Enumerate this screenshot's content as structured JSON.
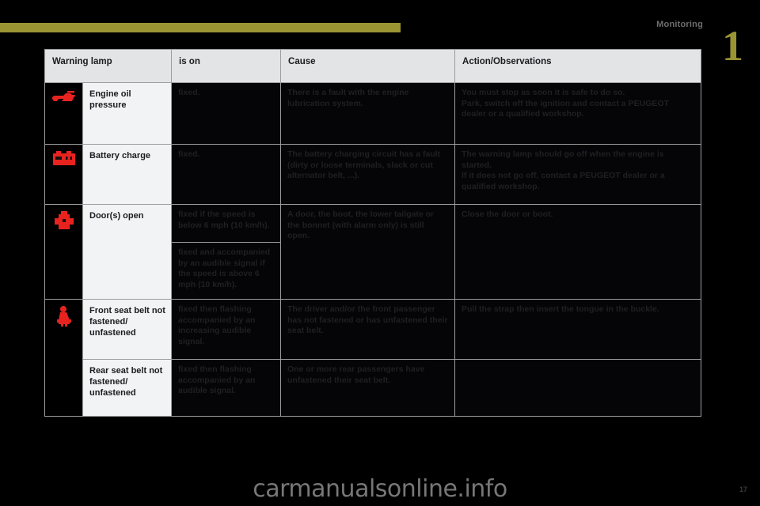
{
  "header": {
    "running_head": "Monitoring",
    "chapter_number": "1"
  },
  "table": {
    "columns": [
      "Warning lamp",
      "is on",
      "Cause",
      "Action/Observations"
    ],
    "rows": [
      {
        "icon": "engine-oil-pressure-icon",
        "lamp": "Engine oil pressure",
        "is_on": [
          "fixed."
        ],
        "cause": "There is a fault with the engine lubrication system.",
        "action": "You must stop as soon it is safe to do so.\nPark, switch off the ignition and contact a PEUGEOT dealer or a qualified workshop."
      },
      {
        "icon": "battery-charge-icon",
        "lamp": "Battery charge",
        "is_on": [
          "fixed."
        ],
        "cause": "The battery charging circuit has a fault (dirty or loose terminals, slack or cut alternator belt, ...).",
        "action": "The warning lamp should go off when the engine is started.\nIf it does not go off, contact a PEUGEOT dealer or a qualified workshop."
      },
      {
        "icon": "doors-open-icon",
        "lamp": "Door(s) open",
        "is_on": [
          "fixed if the speed is below 6 mph (10 km/h).",
          "fixed and accompanied by an audible signal if the speed is above 6 mph (10 km/h)."
        ],
        "cause": "A door, the boot, the lower tailgate or the bonnet (with alarm only) is still open.",
        "action": "Close the door or boot."
      },
      {
        "icon": "front-seat-belt-icon",
        "lamp": "Front seat belt not fastened/ unfastened",
        "is_on": [
          "fixed then flashing accompanied by an increasing audible signal."
        ],
        "cause": "The driver and/or the front passenger has not fastened or has unfastened their seat belt.",
        "action": "Pull the strap then insert the tongue in the buckle."
      },
      {
        "icon": "rear-seat-belt-icon",
        "lamp": "Rear seat belt not fastened/ unfastened",
        "is_on": [
          "fixed then flashing accompanied by an audible signal."
        ],
        "cause": "One or more rear passengers have unfastened their seat belt.",
        "action": ""
      }
    ]
  },
  "footer": {
    "watermark": "carmanualsonline.info",
    "folio": "17"
  },
  "colors": {
    "accent_olive": "#9a9433",
    "warning_red": "#e8231f",
    "header_grey": "#e3e4e6",
    "cell_dark": "#050507"
  }
}
